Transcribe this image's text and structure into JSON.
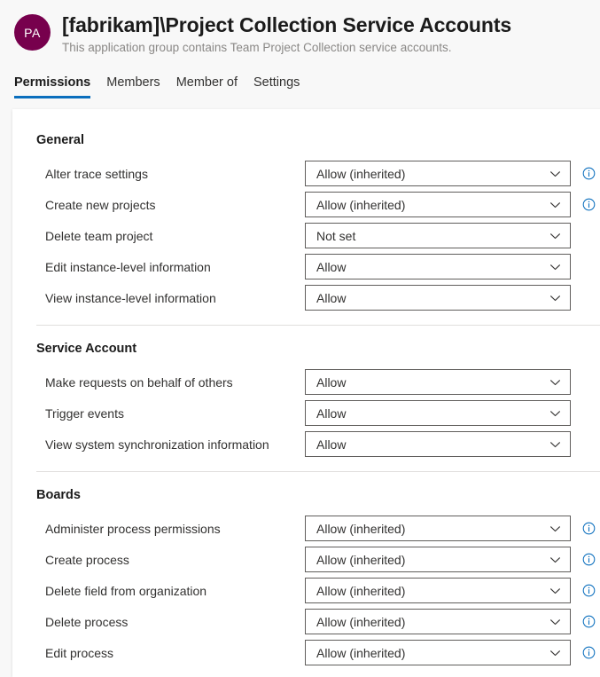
{
  "header": {
    "avatar_initials": "PA",
    "title": "[fabrikam]\\Project Collection Service Accounts",
    "subtitle": "This application group contains Team Project Collection service accounts."
  },
  "tabs": [
    {
      "label": "Permissions",
      "active": true
    },
    {
      "label": "Members",
      "active": false
    },
    {
      "label": "Member of",
      "active": false
    },
    {
      "label": "Settings",
      "active": false
    }
  ],
  "colors": {
    "avatar_bg": "#77004d",
    "tab_accent": "#0a6ebd",
    "info_icon": "#0a6ebd",
    "card_bg": "#ffffff",
    "page_bg": "#f8f8f8",
    "divider": "#e1dfdd",
    "control_border": "#605e5c"
  },
  "icons": {
    "chevron": "chevron-down-icon",
    "info": "info-circle-icon"
  },
  "sections": [
    {
      "title": "General",
      "rows": [
        {
          "label": "Alter trace settings",
          "value": "Allow (inherited)",
          "has_info": true
        },
        {
          "label": "Create new projects",
          "value": "Allow (inherited)",
          "has_info": true
        },
        {
          "label": "Delete team project",
          "value": "Not set",
          "has_info": false
        },
        {
          "label": "Edit instance-level information",
          "value": "Allow",
          "has_info": false
        },
        {
          "label": "View instance-level information",
          "value": "Allow",
          "has_info": false
        }
      ]
    },
    {
      "title": "Service Account",
      "rows": [
        {
          "label": "Make requests on behalf of others",
          "value": "Allow",
          "has_info": false
        },
        {
          "label": "Trigger events",
          "value": "Allow",
          "has_info": false
        },
        {
          "label": "View system synchronization information",
          "value": "Allow",
          "has_info": false
        }
      ]
    },
    {
      "title": "Boards",
      "rows": [
        {
          "label": "Administer process permissions",
          "value": "Allow (inherited)",
          "has_info": true
        },
        {
          "label": "Create process",
          "value": "Allow (inherited)",
          "has_info": true
        },
        {
          "label": "Delete field from organization",
          "value": "Allow (inherited)",
          "has_info": true
        },
        {
          "label": "Delete process",
          "value": "Allow (inherited)",
          "has_info": true
        },
        {
          "label": "Edit process",
          "value": "Allow (inherited)",
          "has_info": true
        }
      ]
    }
  ]
}
